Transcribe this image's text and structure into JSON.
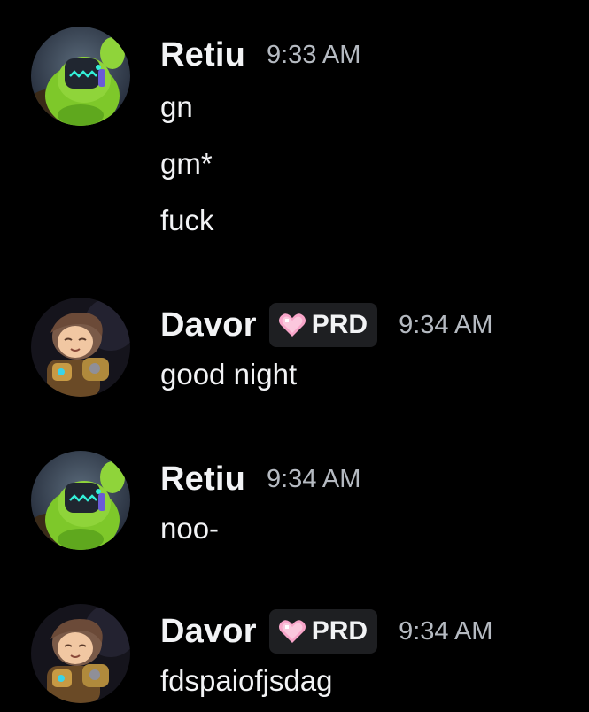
{
  "colors": {
    "background": "#000000",
    "text": "#f2f3f5",
    "timestamp": "#b5bac1",
    "badge_bg": "#1e1f22",
    "badge_heart": "#f8a5c9"
  },
  "messages": [
    {
      "author": "Retiu",
      "avatar": "green-creature-avatar",
      "timestamp": "9:33 AM",
      "lines": [
        "gn",
        "gm*",
        "fuck"
      ]
    },
    {
      "author": "Davor",
      "avatar": "anime-boy-avatar",
      "badge": {
        "icon": "pink-heart-icon",
        "text": "PRD"
      },
      "timestamp": "9:34 AM",
      "lines": [
        "good night"
      ]
    },
    {
      "author": "Retiu",
      "avatar": "green-creature-avatar",
      "timestamp": "9:34 AM",
      "lines": [
        "noo-"
      ]
    },
    {
      "author": "Davor",
      "avatar": "anime-boy-avatar",
      "badge": {
        "icon": "pink-heart-icon",
        "text": "PRD"
      },
      "timestamp": "9:34 AM",
      "lines": [
        "fdspaiofjsdag"
      ]
    }
  ]
}
